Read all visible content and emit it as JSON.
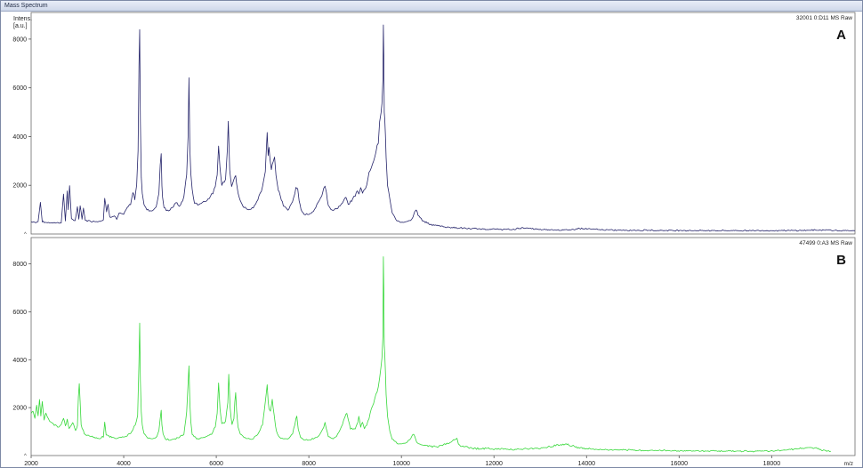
{
  "window": {
    "title": "Mass Spectrum"
  },
  "chart_data": {
    "type": "line",
    "xlim": [
      2000,
      19800
    ],
    "x_ticks": [
      2000,
      4000,
      6000,
      8000,
      10000,
      12000,
      14000,
      16000,
      18000
    ],
    "xlabel": "m/z",
    "ylabel_line1": "Intens.",
    "ylabel_line2": "[a.u.]",
    "panels": [
      {
        "label": "A",
        "header": "32001 0:D11 MS Raw",
        "color": "#26256b",
        "ylim": [
          0,
          8800
        ],
        "y_ticks": [
          2000,
          4000,
          6000,
          8000
        ],
        "series": {
          "x": [
            2000,
            2050,
            2100,
            2150,
            2200,
            2240,
            2280,
            2400,
            2550,
            2650,
            2700,
            2740,
            2780,
            2800,
            2830,
            2870,
            2950,
            3000,
            3030,
            3060,
            3100,
            3130,
            3170,
            3300,
            3450,
            3560,
            3590,
            3630,
            3660,
            3700,
            3800,
            3850,
            3900,
            4000,
            4100,
            4150,
            4200,
            4240,
            4280,
            4310,
            4330,
            4345,
            4360,
            4380,
            4400,
            4440,
            4500,
            4600,
            4700,
            4760,
            4790,
            4810,
            4825,
            4840,
            4870,
            4920,
            5000,
            5100,
            5150,
            5200,
            5300,
            5360,
            5390,
            5410,
            5430,
            5450,
            5480,
            5530,
            5600,
            5700,
            5800,
            5900,
            5980,
            6020,
            6050,
            6080,
            6120,
            6200,
            6240,
            6260,
            6290,
            6330,
            6380,
            6420,
            6440,
            6470,
            6510,
            6560,
            6600,
            6700,
            6800,
            6900,
            7000,
            7060,
            7100,
            7120,
            7140,
            7160,
            7190,
            7230,
            7260,
            7290,
            7320,
            7360,
            7450,
            7550,
            7650,
            7720,
            7760,
            7790,
            7830,
            7900,
            8000,
            8100,
            8200,
            8280,
            8320,
            8350,
            8380,
            8420,
            8500,
            8600,
            8700,
            8800,
            8850,
            8900,
            9000,
            9050,
            9080,
            9120,
            9160,
            9200,
            9250,
            9300,
            9350,
            9400,
            9450,
            9500,
            9530,
            9560,
            9580,
            9600,
            9610,
            9620,
            9630,
            9640,
            9655,
            9670,
            9700,
            9750,
            9800,
            9850,
            9900,
            9950,
            10000,
            10100,
            10200,
            10250,
            10290,
            10320,
            10360,
            10450,
            10600,
            10800,
            11000,
            11200,
            11500,
            11800,
            12200,
            12400,
            12600,
            13000,
            13500,
            13650,
            13800,
            14500,
            15500,
            16500,
            17500,
            18500,
            19200,
            19500,
            19800
          ],
          "y": [
            500,
            500,
            460,
            520,
            1300,
            520,
            480,
            460,
            460,
            470,
            1600,
            520,
            1800,
            1000,
            2000,
            600,
            560,
            1100,
            600,
            1200,
            600,
            1050,
            560,
            520,
            520,
            580,
            1500,
            900,
            1200,
            700,
            750,
            600,
            850,
            800,
            1150,
            1200,
            1700,
            1450,
            2000,
            3400,
            7000,
            8500,
            4500,
            2400,
            1700,
            1200,
            1000,
            950,
            1100,
            1700,
            2800,
            3300,
            2000,
            1500,
            1100,
            950,
            1000,
            1200,
            1300,
            1100,
            1500,
            2500,
            4000,
            6300,
            3500,
            2500,
            1800,
            1300,
            1200,
            1300,
            1400,
            1600,
            1900,
            2500,
            3600,
            2700,
            2000,
            2300,
            3500,
            4600,
            2700,
            2000,
            2300,
            2400,
            2000,
            1700,
            1400,
            1200,
            1100,
            1000,
            1100,
            1400,
            1900,
            2600,
            4200,
            3300,
            3600,
            3100,
            2700,
            3000,
            3200,
            2400,
            2000,
            1700,
            1200,
            1000,
            1300,
            1900,
            1800,
            1400,
            1000,
            800,
            800,
            900,
            1300,
            1600,
            1900,
            2000,
            1700,
            1200,
            950,
            1050,
            1200,
            1500,
            1200,
            1300,
            1600,
            1800,
            1600,
            1900,
            1700,
            1850,
            2000,
            2500,
            2800,
            3000,
            3400,
            3800,
            4500,
            4900,
            5400,
            6300,
            8600,
            7500,
            5000,
            4600,
            4000,
            3200,
            2000,
            1400,
            900,
            700,
            560,
            500,
            470,
            500,
            560,
            700,
            900,
            1000,
            800,
            560,
            420,
            330,
            280,
            250,
            220,
            200,
            190,
            180,
            260,
            180,
            170,
            160,
            230,
            160,
            150,
            140,
            140,
            140,
            170,
            130,
            130
          ]
        }
      },
      {
        "label": "B",
        "header": "47499 0:A3 MS Raw",
        "color": "#37d83a",
        "ylim": [
          0,
          8800
        ],
        "y_ticks": [
          2000,
          4000,
          6000,
          8000
        ],
        "series": {
          "x": [
            2000,
            2040,
            2080,
            2120,
            2150,
            2180,
            2210,
            2240,
            2280,
            2320,
            2400,
            2500,
            2600,
            2650,
            2700,
            2740,
            2780,
            2820,
            2900,
            2960,
            3000,
            3020,
            3040,
            3080,
            3150,
            3300,
            3450,
            3560,
            3590,
            3620,
            3700,
            3850,
            3950,
            4050,
            4150,
            4200,
            4250,
            4300,
            4330,
            4345,
            4360,
            4380,
            4400,
            4440,
            4520,
            4600,
            4700,
            4760,
            4790,
            4810,
            4825,
            4850,
            4900,
            5000,
            5100,
            5200,
            5300,
            5360,
            5390,
            5410,
            5430,
            5450,
            5480,
            5540,
            5600,
            5700,
            5800,
            5900,
            5980,
            6020,
            6050,
            6080,
            6120,
            6200,
            6250,
            6270,
            6300,
            6340,
            6380,
            6420,
            6440,
            6470,
            6520,
            6600,
            6700,
            6800,
            6900,
            7000,
            7060,
            7100,
            7120,
            7140,
            7170,
            7210,
            7250,
            7280,
            7320,
            7400,
            7550,
            7650,
            7720,
            7740,
            7770,
            7820,
            7900,
            8000,
            8100,
            8200,
            8280,
            8320,
            8350,
            8380,
            8420,
            8500,
            8600,
            8700,
            8780,
            8820,
            8850,
            8900,
            9000,
            9040,
            9080,
            9120,
            9160,
            9200,
            9250,
            9300,
            9350,
            9400,
            9450,
            9500,
            9530,
            9560,
            9580,
            9600,
            9610,
            9620,
            9630,
            9640,
            9655,
            9670,
            9700,
            9750,
            9800,
            9850,
            9900,
            9950,
            10000,
            10100,
            10200,
            10250,
            10290,
            10330,
            10400,
            10600,
            10800,
            11000,
            11100,
            11200,
            11230,
            11280,
            11400,
            11600,
            12000,
            12500,
            13000,
            13400,
            13600,
            13800,
            14200,
            15000,
            16000,
            17000,
            18000,
            18500,
            18900,
            19100,
            19300,
            19800
          ],
          "y": [
            1700,
            1900,
            1600,
            2100,
            1700,
            2300,
            1600,
            2200,
            1500,
            1800,
            1400,
            1300,
            1200,
            1300,
            1600,
            1200,
            1500,
            1100,
            1400,
            1000,
            1200,
            2500,
            3100,
            1300,
            900,
            800,
            700,
            800,
            1400,
            900,
            800,
            700,
            750,
            800,
            950,
            1100,
            1300,
            1700,
            3800,
            5700,
            3200,
            1800,
            1300,
            900,
            750,
            700,
            750,
            1000,
            1600,
            1900,
            1300,
            900,
            700,
            650,
            700,
            750,
            900,
            1800,
            3000,
            3700,
            2200,
            1400,
            900,
            750,
            700,
            720,
            800,
            900,
            1200,
            1800,
            3000,
            2000,
            1300,
            1400,
            2200,
            3400,
            2000,
            1300,
            1600,
            2700,
            1800,
            1200,
            900,
            750,
            700,
            700,
            900,
            1300,
            2200,
            3000,
            2200,
            2000,
            1900,
            2300,
            1700,
            1200,
            900,
            700,
            700,
            900,
            1500,
            1600,
            1100,
            750,
            650,
            650,
            700,
            800,
            1000,
            1200,
            1400,
            1100,
            800,
            700,
            800,
            1200,
            1600,
            1800,
            1500,
            1100,
            1100,
            1300,
            1600,
            1200,
            1400,
            1100,
            1300,
            1600,
            2000,
            2200,
            2500,
            2800,
            3300,
            3700,
            4100,
            5000,
            8500,
            7000,
            4500,
            4200,
            3500,
            2600,
            1600,
            1000,
            700,
            600,
            520,
            480,
            480,
            550,
            700,
            900,
            800,
            550,
            450,
            400,
            380,
            500,
            620,
            750,
            500,
            400,
            350,
            300,
            280,
            260,
            300,
            450,
            470,
            330,
            250,
            220,
            200,
            190,
            180,
            280,
            330,
            220,
            180
          ]
        }
      }
    ]
  }
}
